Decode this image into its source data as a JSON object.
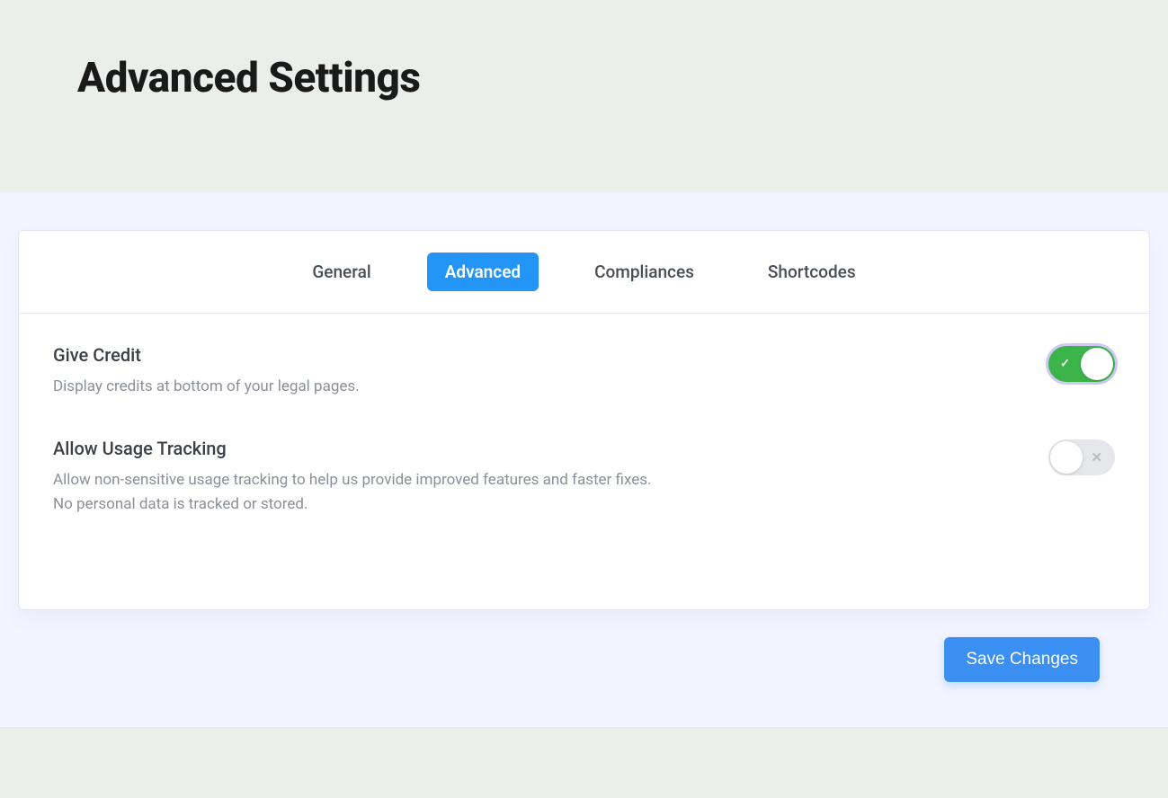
{
  "header": {
    "title": "Advanced Settings"
  },
  "tabs": {
    "general": "General",
    "advanced": "Advanced",
    "compliances": "Compliances",
    "shortcodes": "Shortcodes"
  },
  "settings": {
    "give_credit": {
      "title": "Give Credit",
      "desc": "Display credits at bottom of your legal pages.",
      "enabled": true
    },
    "usage_tracking": {
      "title": "Allow Usage Tracking",
      "desc": "Allow non-sensitive usage tracking to help us provide improved features and faster fixes. No personal data is tracked or stored.",
      "enabled": false
    }
  },
  "actions": {
    "save": "Save Changes"
  }
}
